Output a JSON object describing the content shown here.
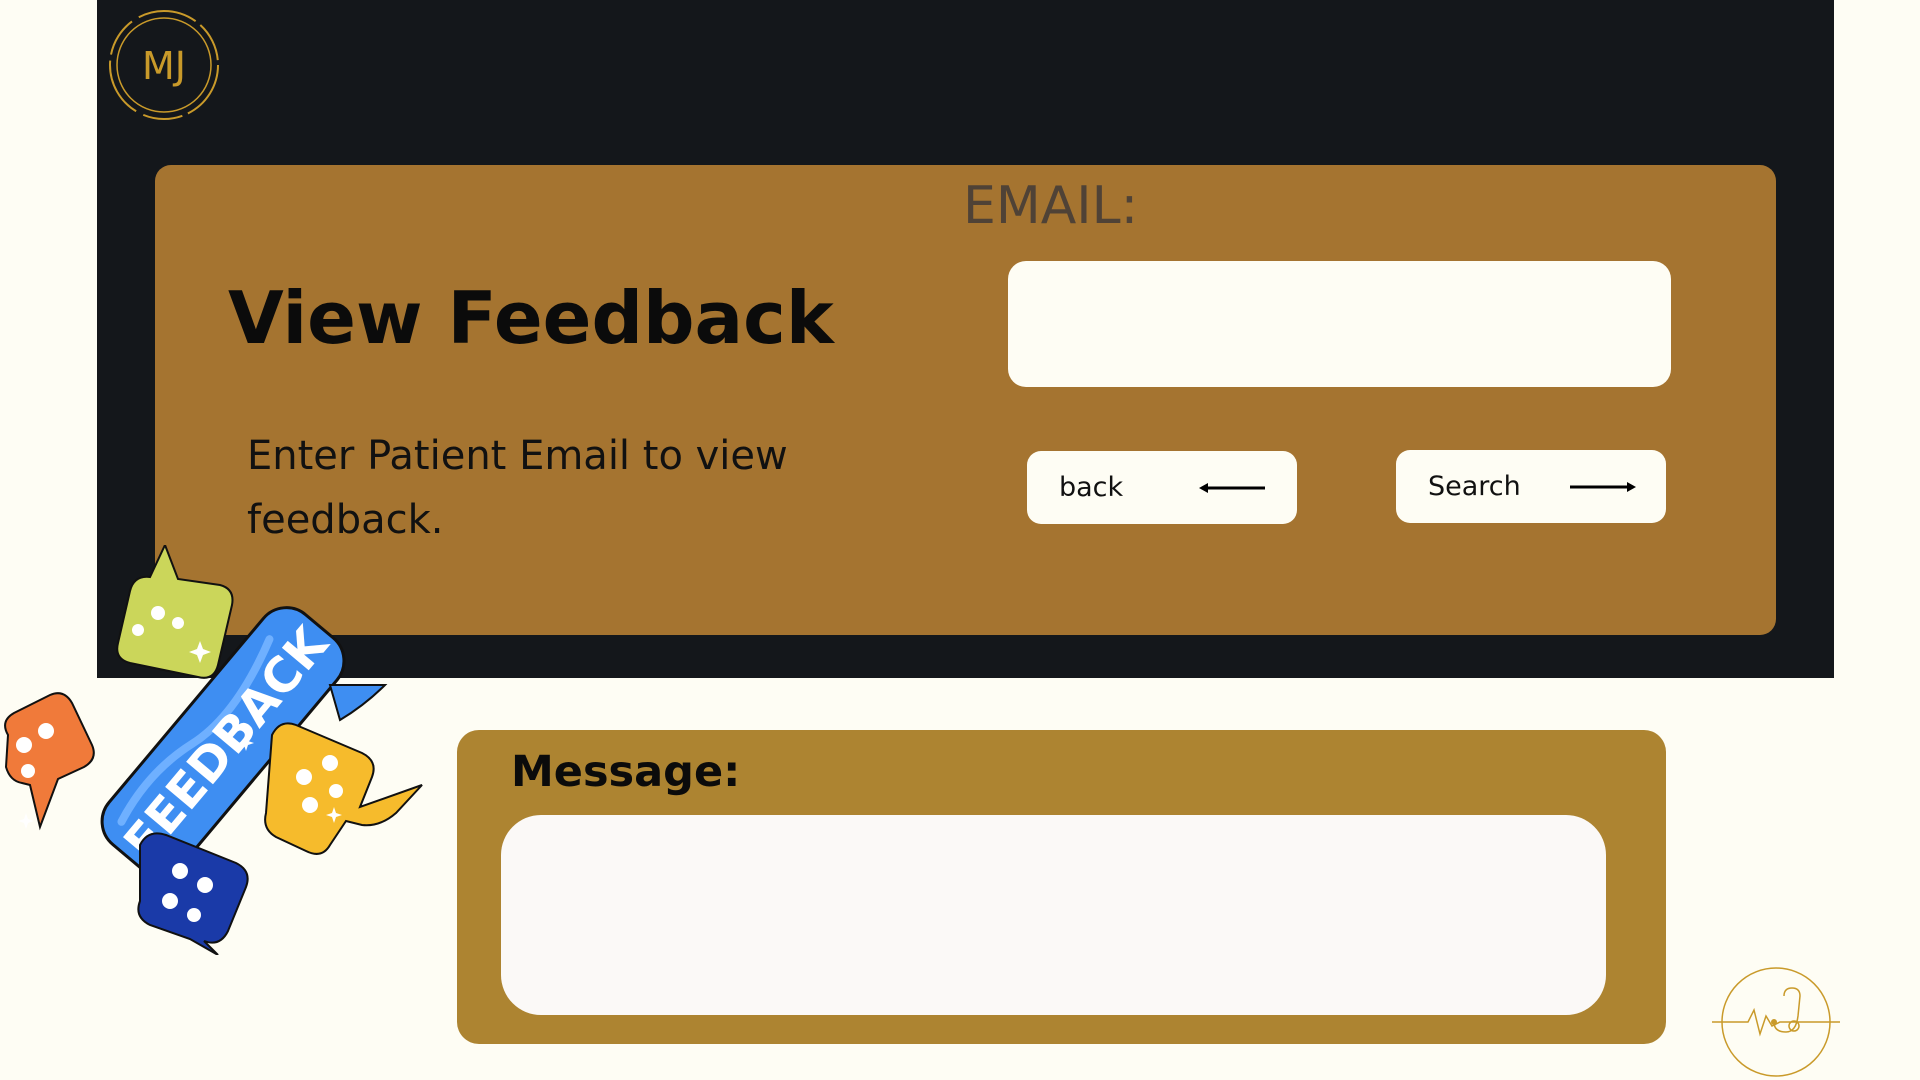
{
  "brand": {
    "logo_icon": "mj-monogram-logo-icon",
    "logo_text": "MJ",
    "footer_logo_icon": "heartbeat-stethoscope-logo-icon"
  },
  "header": {
    "title": "View Feedback",
    "instructions": "Enter Patient Email to view feedback."
  },
  "email": {
    "label": "EMAIL:",
    "value": "",
    "placeholder": ""
  },
  "actions": {
    "back_label": "back",
    "back_icon": "arrow-left-icon",
    "search_label": "Search",
    "search_icon": "arrow-right-icon"
  },
  "message": {
    "label": "Message:",
    "value": "",
    "placeholder": ""
  },
  "illustration": {
    "icon": "feedback-speech-bubbles-illustration",
    "banner_text": "FEEDBACK"
  },
  "colors": {
    "page_background": "#fefdf4",
    "top_panel": "#14171b",
    "card": "#a57430",
    "message_card": "#ad8431",
    "gold_accent": "#c99a2a",
    "email_label": "#4f4236"
  }
}
